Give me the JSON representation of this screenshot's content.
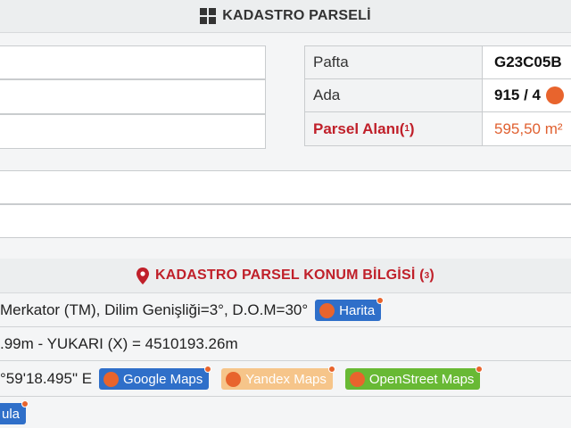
{
  "kadastro": {
    "title": "KADASTRO PARSELİ",
    "rows": [
      {
        "label": "Pafta",
        "value": "G23C05B"
      },
      {
        "label": "Ada",
        "value": "915 / 4"
      },
      {
        "label_text": "Parsel Alanı(",
        "label_sup": "1",
        "label_close": ")",
        "value": "595,50 m²"
      }
    ]
  },
  "konum": {
    "title_text": "KADASTRO PARSEL KONUM BİLGİSİ (",
    "title_sup": "3",
    "title_close": ")",
    "projection_text": "Merkator (TM), Dilim Genişliği=3°, D.O.M=30°",
    "harita_label": "Harita",
    "coords_text": ".99m - YUKARI (X) = 4510193.26m",
    "lon_text": "°59'18.495\" E",
    "maps": {
      "google": "Google Maps",
      "yandex": "Yandex Maps",
      "osm": "OpenStreet Maps"
    },
    "last_btn": "ula"
  },
  "colors": {
    "accent_red": "#c0202a",
    "button_blue": "#2f6fc9",
    "osm_green": "#68b934",
    "yandex_orange": "#f6c58a",
    "globe_orange": "#e8642d"
  }
}
